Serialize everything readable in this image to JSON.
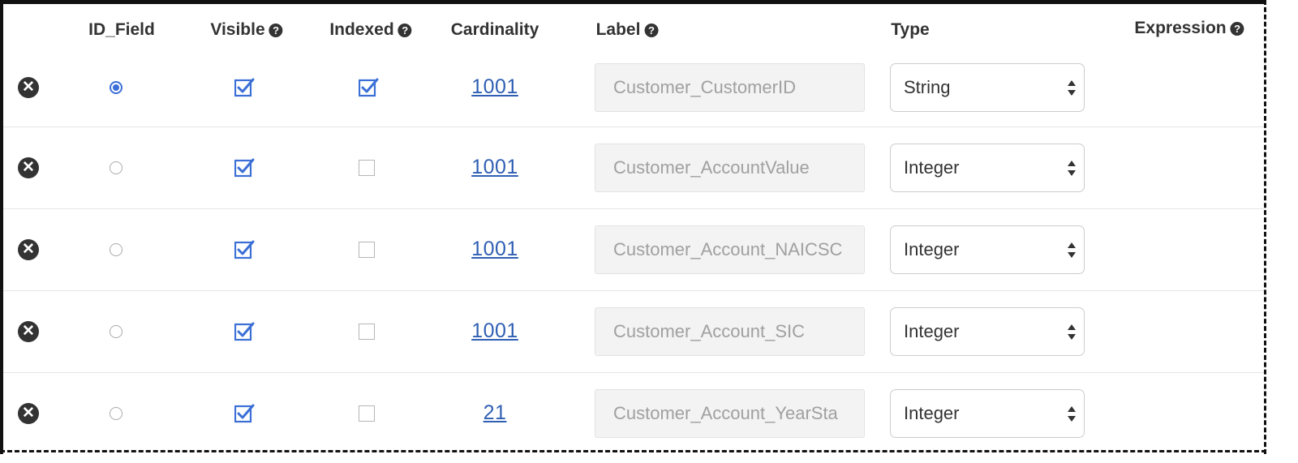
{
  "headers": {
    "id_field": "ID_Field",
    "visible": "Visible",
    "indexed": "Indexed",
    "cardinality": "Cardinality",
    "label": "Label",
    "type": "Type",
    "expression": "Expression"
  },
  "help_icon_glyph": "?",
  "remove_icon_glyph": "✕",
  "accent_color": "#3b6fd6",
  "rows": [
    {
      "id_field": true,
      "visible": true,
      "indexed": true,
      "cardinality": "1001",
      "label": "Customer_CustomerID",
      "type": "String"
    },
    {
      "id_field": false,
      "visible": true,
      "indexed": false,
      "cardinality": "1001",
      "label": "Customer_AccountValue",
      "type": "Integer"
    },
    {
      "id_field": false,
      "visible": true,
      "indexed": false,
      "cardinality": "1001",
      "label": "Customer_Account_NAICSC",
      "type": "Integer"
    },
    {
      "id_field": false,
      "visible": true,
      "indexed": false,
      "cardinality": "1001",
      "label": "Customer_Account_SIC",
      "type": "Integer"
    },
    {
      "id_field": false,
      "visible": true,
      "indexed": false,
      "cardinality": "21",
      "label": "Customer_Account_YearSta",
      "type": "Integer"
    }
  ]
}
